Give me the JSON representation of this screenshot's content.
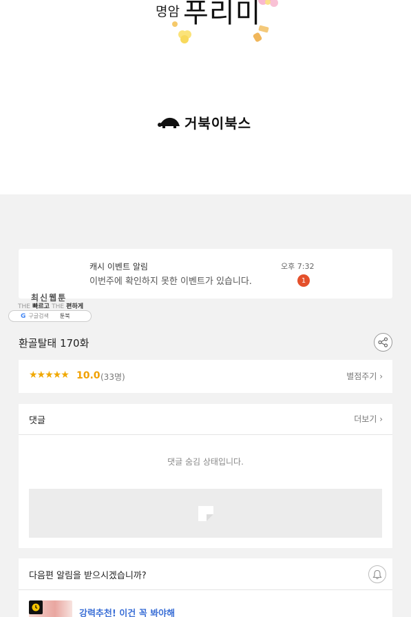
{
  "banner": {
    "prefix": "명암",
    "title": "푸리미",
    "publisher": "거북이북스",
    "publisher_logo_icon": "turtle-icon"
  },
  "notification": {
    "title": "캐시 이벤트 알림",
    "message": "이번주에 확인하지 못한 이벤트가 있습니다.",
    "time": "오후 7:32",
    "count": "1"
  },
  "ad": {
    "title": "최신웹툰",
    "tagline_the1": "THE",
    "tagline_word1": "빠르고",
    "tagline_the2": "THE",
    "tagline_word2": "편하게",
    "search_label": "구글검색",
    "brand": "툰북"
  },
  "episode": {
    "title": "환골탈태 170화",
    "share_icon": "share-icon"
  },
  "rating": {
    "stars": "★★★★★",
    "score": "10.0",
    "raters": "(33명)",
    "rate_link": "별점주기 ›"
  },
  "comments": {
    "label": "댓글",
    "more_link": "더보기 ›",
    "hidden_message": "댓글 숨김 상태입니다."
  },
  "next_episode": {
    "question": "다음편 알림을 받으시겠습니까?",
    "bell_icon": "bell-icon",
    "recommend_text": "강력추천! 이건 꼭 봐야해"
  },
  "colors": {
    "accent_star": "#f0a800",
    "badge_red": "#e4502b",
    "link_blue": "#3b6fd6",
    "page_bg": "#f2f2f2"
  }
}
